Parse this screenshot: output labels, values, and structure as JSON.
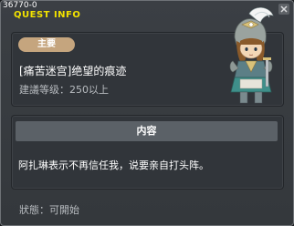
{
  "window": {
    "quest_id": "36770-0",
    "title": "QUEST INFO"
  },
  "quest": {
    "badge": "主要",
    "name": "[痛苦迷宫]绝望的痕迹",
    "required_level": "建議等级：250以上"
  },
  "content": {
    "header": "内容",
    "text": "阿扎琳表示不再信任我，说要亲自打头阵。"
  },
  "status": {
    "label": "狀態：",
    "value": "可開始"
  },
  "colors": {
    "title": "#f2e200",
    "badge": "#c5a57e",
    "panel": "#31353a"
  },
  "icons": {
    "close": "close-icon",
    "npc": "npc-knight-portrait"
  }
}
